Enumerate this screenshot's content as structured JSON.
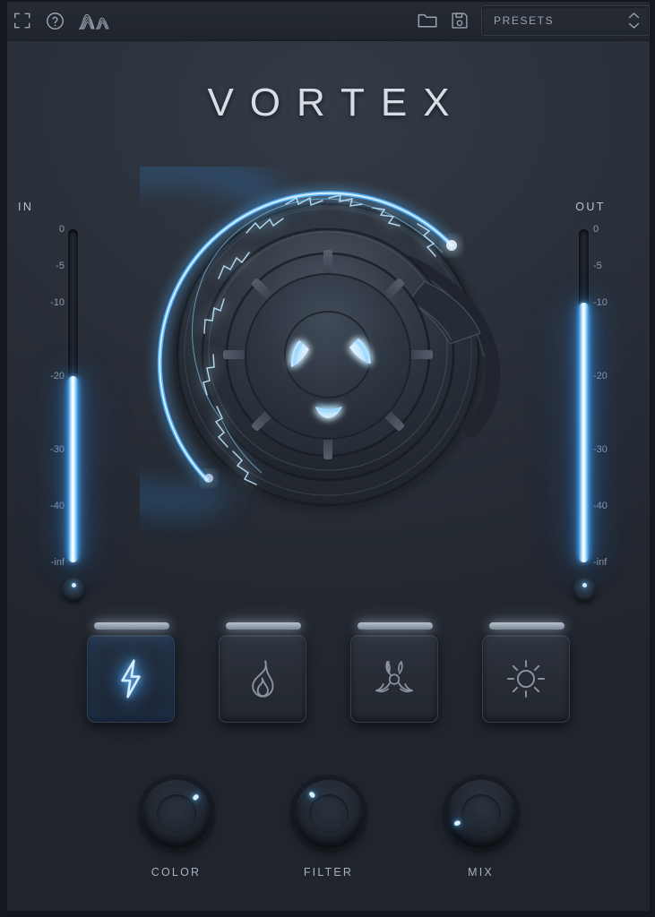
{
  "app": {
    "title": "VORTEX"
  },
  "header": {
    "icons": [
      {
        "name": "resize-icon",
        "label": "Resize"
      },
      {
        "name": "help-icon",
        "label": "Help"
      },
      {
        "name": "spectrum-icon",
        "label": "Spectrum"
      }
    ],
    "open_label": "Open",
    "save_label": "Save",
    "presets": {
      "value": "PRESETS",
      "placeholder": "PRESETS"
    }
  },
  "meters": {
    "input": {
      "title": "IN",
      "scale": [
        "0",
        "-5",
        "-10",
        "-20",
        "-30",
        "-40",
        "-inf"
      ],
      "scale_pos": [
        0,
        11,
        22,
        44,
        66,
        83,
        100
      ],
      "level_pct": 56,
      "level_label": "-20"
    },
    "output": {
      "title": "OUT",
      "scale": [
        "0",
        "-5",
        "-10",
        "-20",
        "-30",
        "-40",
        "-inf"
      ],
      "scale_pos": [
        0,
        11,
        22,
        44,
        66,
        83,
        100
      ],
      "level_pct": 78,
      "level_label": "-10"
    }
  },
  "vortex": {
    "name": "drive-knob",
    "arc_deg": 250,
    "value_pct": 69
  },
  "buttons": [
    {
      "name": "mode-lightning",
      "icon": "lightning-icon",
      "label": "Lightning",
      "active": true
    },
    {
      "name": "mode-flame",
      "icon": "flame-icon",
      "label": "Flame",
      "active": false
    },
    {
      "name": "mode-biohazard",
      "icon": "biohazard-icon",
      "label": "Biohazard",
      "active": false
    },
    {
      "name": "mode-sun",
      "icon": "sun-icon",
      "label": "Sun",
      "active": false
    }
  ],
  "knobs": [
    {
      "name": "color-knob",
      "label": "COLOR",
      "angle": 48,
      "value_pct": 63
    },
    {
      "name": "filter-knob",
      "label": "FILTER",
      "angle": -42,
      "value_pct": 38
    },
    {
      "name": "mix-knob",
      "label": "MIX",
      "angle": -112,
      "value_pct": 13
    }
  ],
  "colors": {
    "accent": "#4fb0ff",
    "accent_bright": "#ffffff",
    "panel": "#2b313b",
    "frame": "#14171d",
    "header": "#252a33",
    "text": "#b9c1cc",
    "text_dim": "#8e97a4"
  }
}
